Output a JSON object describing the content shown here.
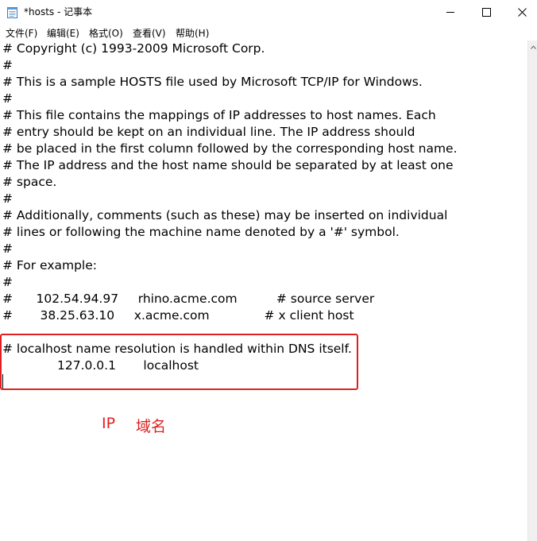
{
  "window": {
    "title": "*hosts - 记事本"
  },
  "menu": {
    "items": [
      "文件(F)",
      "编辑(E)",
      "格式(O)",
      "查看(V)",
      "帮助(H)"
    ]
  },
  "editor": {
    "lines": [
      "# Copyright (c) 1993-2009 Microsoft Corp.",
      "#",
      "# This is a sample HOSTS file used by Microsoft TCP/IP for Windows.",
      "#",
      "# This file contains the mappings of IP addresses to host names. Each",
      "# entry should be kept on an individual line. The IP address should",
      "# be placed in the first column followed by the corresponding host name.",
      "# The IP address and the host name should be separated by at least one",
      "# space.",
      "#",
      "# Additionally, comments (such as these) may be inserted on individual",
      "# lines or following the machine name denoted by a '#' symbol.",
      "#",
      "# For example:",
      "#",
      "#      102.54.94.97     rhino.acme.com          # source server",
      "#       38.25.63.10     x.acme.com              # x client host",
      "",
      "# localhost name resolution is handled within DNS itself.",
      "              127.0.0.1       localhost"
    ]
  },
  "annotation": {
    "ip_label": "IP",
    "domain_label": "域名",
    "color": "#e02020"
  }
}
